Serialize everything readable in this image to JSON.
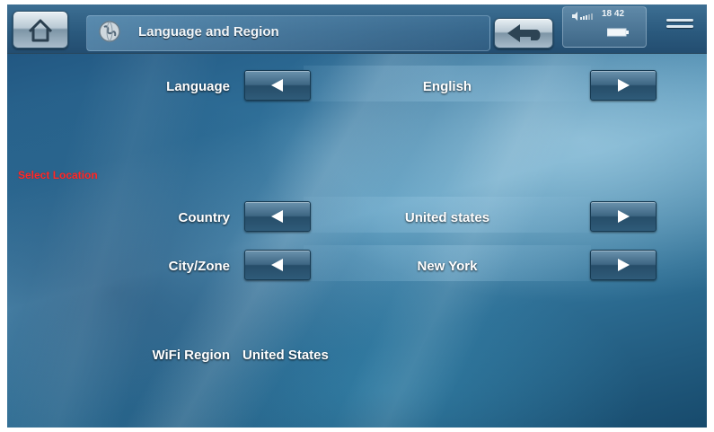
{
  "header": {
    "title": "Language and Region",
    "clock": "18 42",
    "icons": [
      "home-icon",
      "globe-icon",
      "back-arrow-icon",
      "volume-icon",
      "battery-icon",
      "menu-icon"
    ]
  },
  "language": {
    "label": "Language",
    "value": "English"
  },
  "location": {
    "section_title": "Select Location",
    "country": {
      "label": "Country",
      "value": "United states"
    },
    "city": {
      "label": "City/Zone",
      "value": "New York"
    }
  },
  "wifi": {
    "label": "WiFi Region",
    "value": "United States"
  },
  "colors": {
    "section_title": "#ff2a2a",
    "text": "#ffffff",
    "bar": "#2b5a7e"
  }
}
